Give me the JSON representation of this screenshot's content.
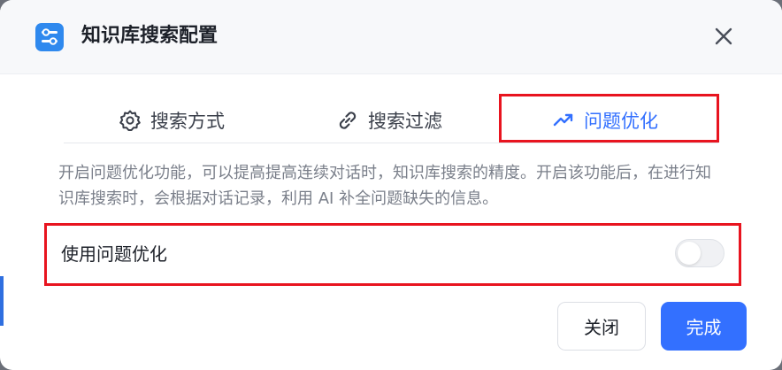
{
  "dialog": {
    "title": "知识库搜索配置",
    "icon": "sliders-icon",
    "close_icon": "close-icon"
  },
  "tabs": [
    {
      "label": "搜索方式",
      "icon": "gear-icon",
      "active": false
    },
    {
      "label": "搜索过滤",
      "icon": "link-icon",
      "active": false
    },
    {
      "label": "问题优化",
      "icon": "trend-up-icon",
      "active": true
    }
  ],
  "content": {
    "description": "开启问题优化功能，可以提高提高连续对话时，知识库搜索的精度。开启该功能后，在进行知识库搜索时，会根据对话记录，利用 AI 补全问题缺失的信息。",
    "setting_label": "使用问题优化",
    "toggle_on": false
  },
  "footer": {
    "close_label": "关闭",
    "done_label": "完成"
  },
  "colors": {
    "accent": "#3370ff",
    "highlight": "#e8141f",
    "header_bg": "#f7f8fa"
  }
}
